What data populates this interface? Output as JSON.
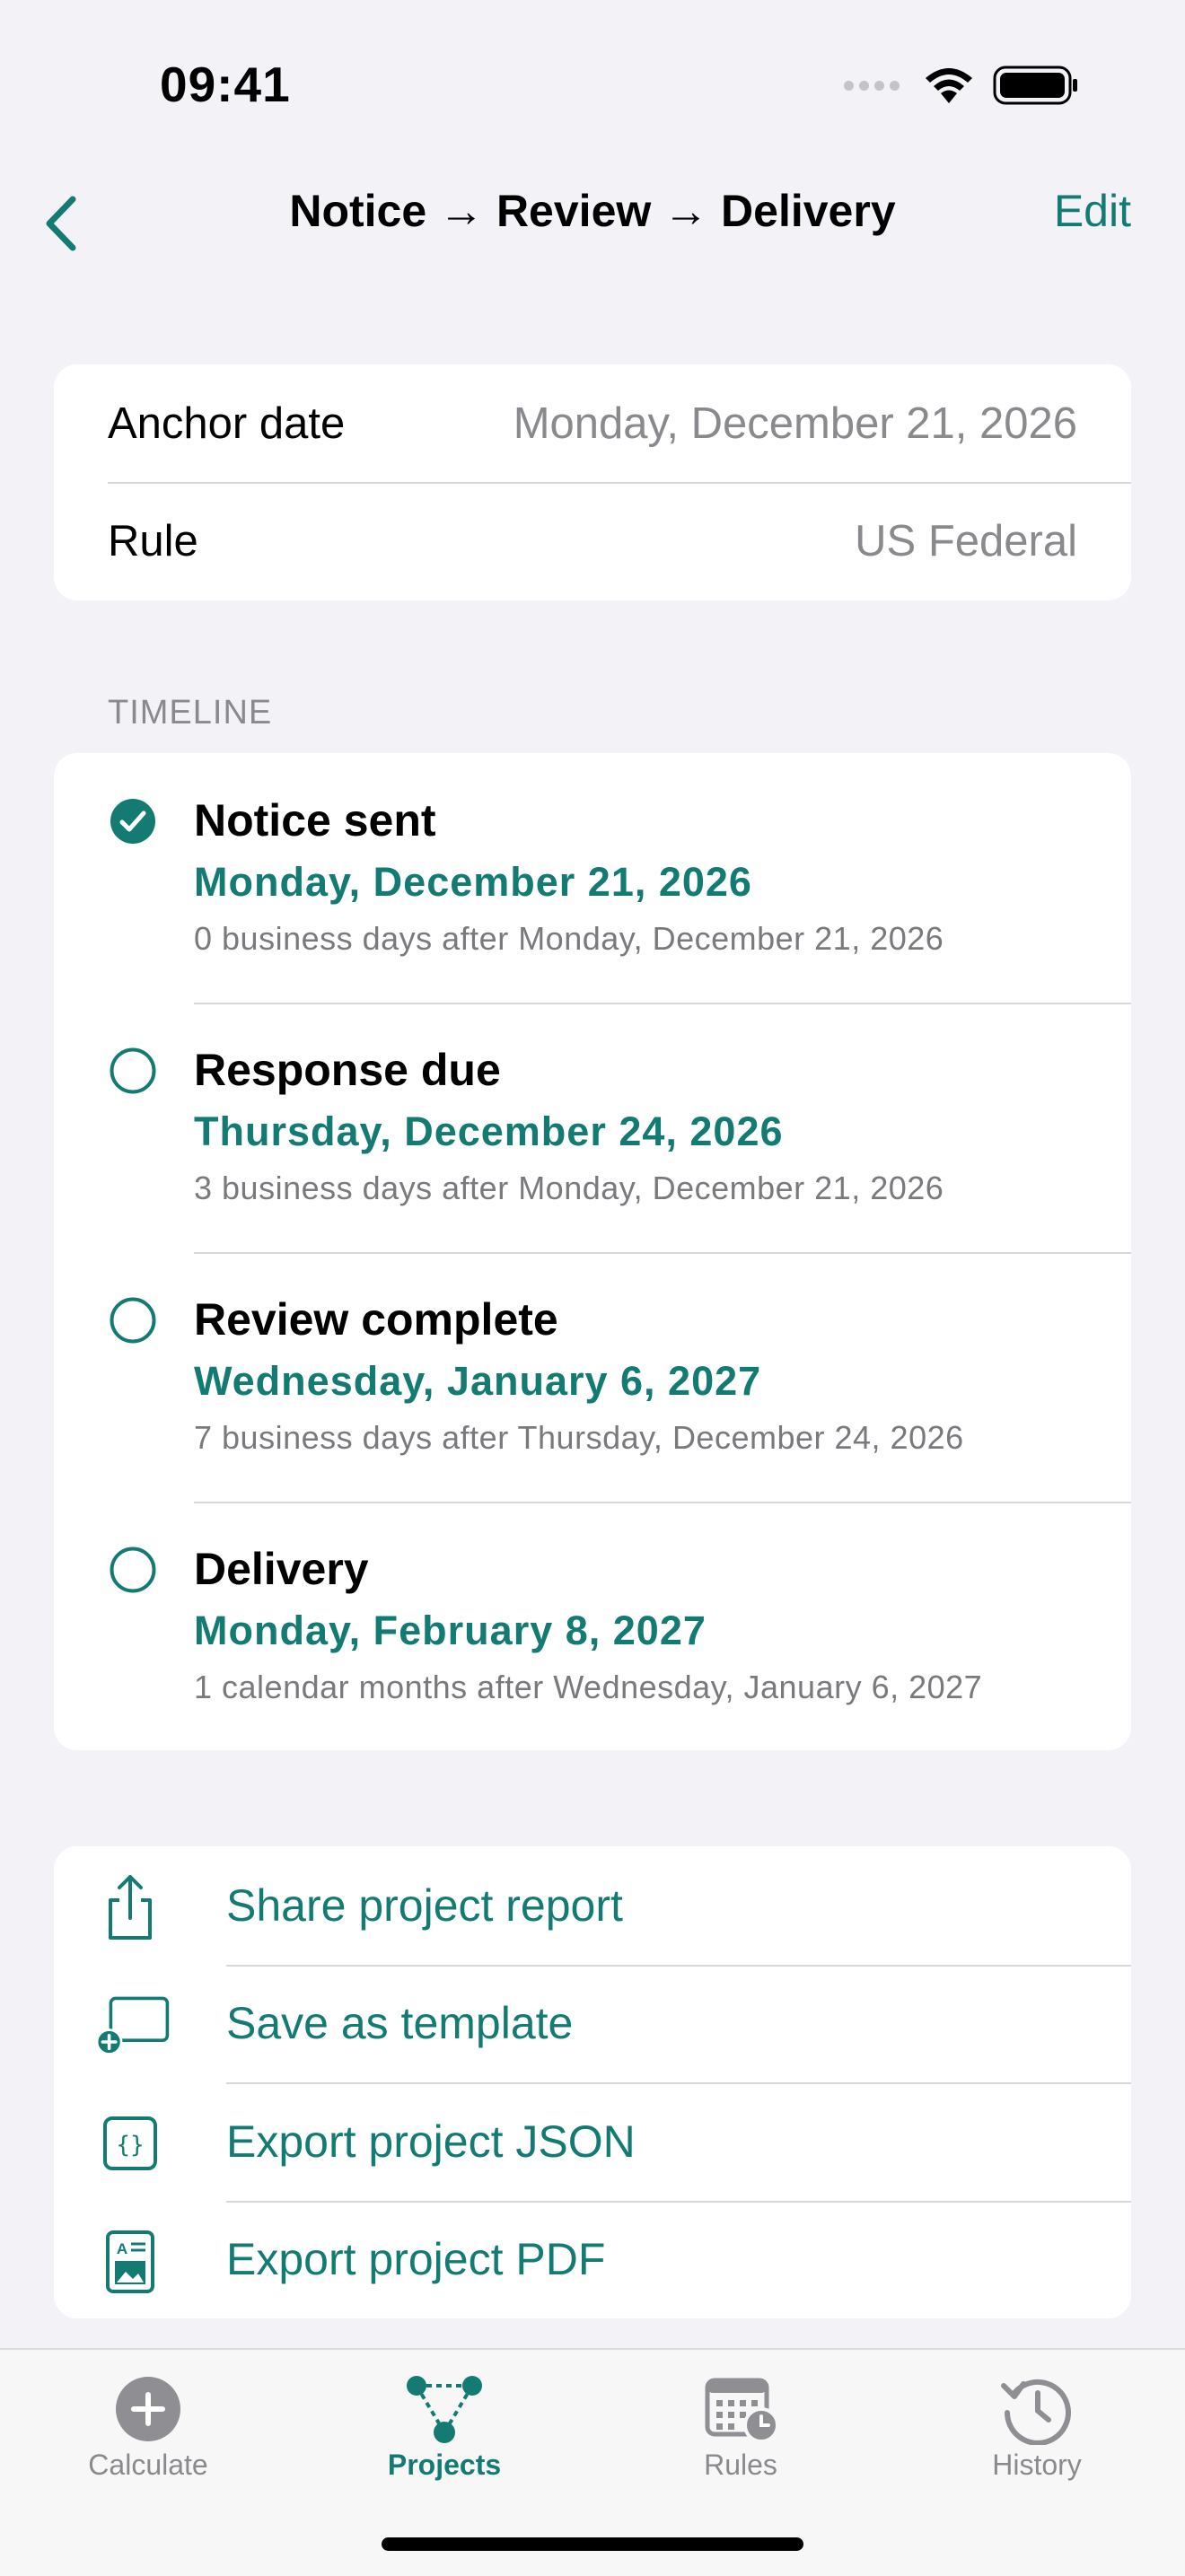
{
  "status_bar": {
    "time": "09:41"
  },
  "nav": {
    "title": "Notice → Review → Delivery",
    "edit_label": "Edit"
  },
  "info": [
    {
      "label": "Anchor date",
      "value": "Monday, December 21, 2026"
    },
    {
      "label": "Rule",
      "value": "US Federal"
    }
  ],
  "timeline": {
    "header": "TIMELINE",
    "items": [
      {
        "name": "Notice sent",
        "date": "Monday, December 21, 2026",
        "desc": "0 business days after Monday, December 21, 2026",
        "done": true
      },
      {
        "name": "Response due",
        "date": "Thursday, December 24, 2026",
        "desc": "3 business days after Monday, December 21, 2026",
        "done": false
      },
      {
        "name": "Review complete",
        "date": "Wednesday, January 6, 2027",
        "desc": "7 business days after Thursday, December 24, 2026",
        "done": false
      },
      {
        "name": "Delivery",
        "date": "Monday, February 8, 2027",
        "desc": "1 calendar months after Wednesday, January 6, 2027",
        "done": false
      }
    ]
  },
  "actions": [
    {
      "label": "Share project report",
      "icon": "share-icon"
    },
    {
      "label": "Save as template",
      "icon": "template-add-icon"
    },
    {
      "label": "Export project JSON",
      "icon": "json-icon"
    },
    {
      "label": "Export project PDF",
      "icon": "pdf-icon"
    }
  ],
  "tabs": [
    {
      "label": "Calculate",
      "icon": "plus-circle-icon",
      "active": false
    },
    {
      "label": "Projects",
      "icon": "projects-icon",
      "active": true
    },
    {
      "label": "Rules",
      "icon": "calendar-clock-icon",
      "active": false
    },
    {
      "label": "History",
      "icon": "history-icon",
      "active": false
    }
  ],
  "colors": {
    "accent": "#137B72",
    "background": "#F2F2F7",
    "secondary_text": "#8A8A8E"
  }
}
